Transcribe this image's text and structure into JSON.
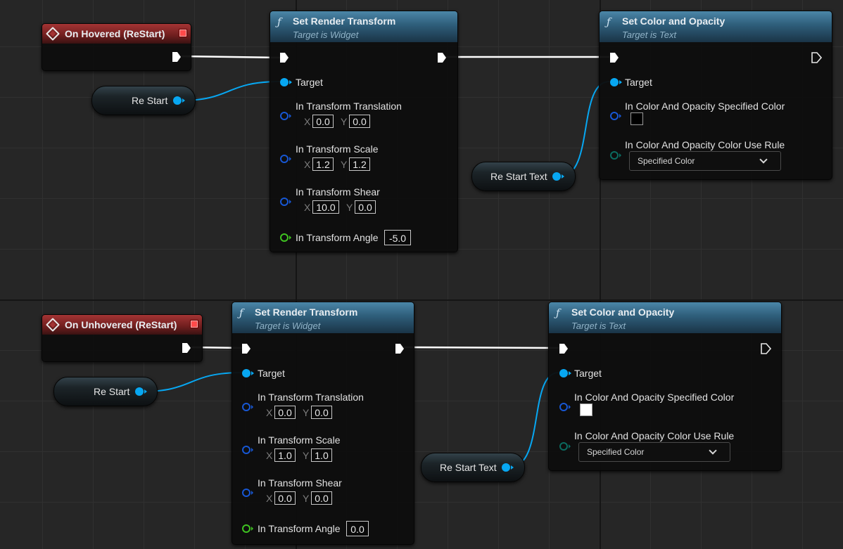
{
  "graph": {
    "top": {
      "event": {
        "title": "On Hovered (ReStart)"
      },
      "var_button": {
        "label": "Re Start"
      },
      "set_render_transform": {
        "title": "Set Render Transform",
        "subtitle": "Target is Widget",
        "target_label": "Target",
        "translation_label": "In Transform Translation",
        "translation": {
          "x_label": "X",
          "x": "0.0",
          "y_label": "Y",
          "y": "0.0"
        },
        "scale_label": "In Transform Scale",
        "scale": {
          "x_label": "X",
          "x": "1.2",
          "y_label": "Y",
          "y": "1.2"
        },
        "shear_label": "In Transform Shear",
        "shear": {
          "x_label": "X",
          "x": "10.0",
          "y_label": "Y",
          "y": "0.0"
        },
        "angle_label": "In Transform Angle",
        "angle": "-5.0"
      },
      "var_text": {
        "label": "Re Start Text"
      },
      "set_color": {
        "title": "Set Color and Opacity",
        "subtitle": "Target is Text",
        "target_label": "Target",
        "color_label": "In Color And Opacity Specified Color",
        "swatch_color": "#000000",
        "rule_label": "In Color And Opacity Color Use Rule",
        "rule_value": "Specified Color"
      }
    },
    "bottom": {
      "event": {
        "title": "On Unhovered (ReStart)"
      },
      "var_button": {
        "label": "Re Start"
      },
      "set_render_transform": {
        "title": "Set Render Transform",
        "subtitle": "Target is Widget",
        "target_label": "Target",
        "translation_label": "In Transform Translation",
        "translation": {
          "x_label": "X",
          "x": "0.0",
          "y_label": "Y",
          "y": "0.0"
        },
        "scale_label": "In Transform Scale",
        "scale": {
          "x_label": "X",
          "x": "1.0",
          "y_label": "Y",
          "y": "1.0"
        },
        "shear_label": "In Transform Shear",
        "shear": {
          "x_label": "X",
          "x": "0.0",
          "y_label": "Y",
          "y": "0.0"
        },
        "angle_label": "In Transform Angle",
        "angle": "0.0"
      },
      "var_text": {
        "label": "Re Start Text"
      },
      "set_color": {
        "title": "Set Color and Opacity",
        "subtitle": "Target is Text",
        "target_label": "Target",
        "color_label": "In Color And Opacity Specified Color",
        "swatch_color": "#ffffff",
        "rule_label": "In Color And Opacity Color Use Rule",
        "rule_value": "Specified Color"
      }
    }
  },
  "colors": {
    "exec_wire": "#ffffff",
    "object_wire": "#07a7f2",
    "event_header": "#a43434",
    "function_header": "#3a6f8f"
  }
}
